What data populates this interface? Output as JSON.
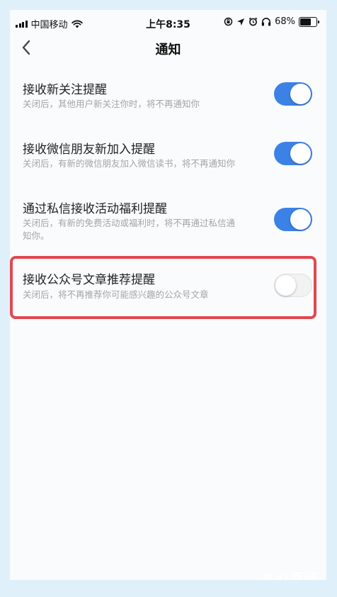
{
  "status_bar": {
    "carrier": "中国移动",
    "time": "上午8:35",
    "battery_percent": "68%",
    "battery_level": 0.68,
    "icons": [
      "signal-icon",
      "wifi-icon",
      "orientation-lock-icon",
      "location-icon",
      "alarm-icon",
      "headphones-icon",
      "battery-icon"
    ]
  },
  "nav": {
    "title": "通知",
    "back_icon": "chevron-left-icon"
  },
  "settings": [
    {
      "title": "接收新关注提醒",
      "description": "关闭后，其他用户新关注你时，将不再通知你",
      "enabled": true
    },
    {
      "title": "接收微信朋友新加入提醒",
      "description": "关闭后，有新的微信朋友加入微信读书，将不再通知你",
      "enabled": true
    },
    {
      "title": "通过私信接收活动福利提醒",
      "description": "关闭后，有新的免费活动或福利时，将不再通过私信通知你。",
      "enabled": true
    },
    {
      "title": "接收公众号文章推荐提醒",
      "description": "关闭后，将不再推荐你可能感兴趣的公众号文章",
      "enabled": false
    }
  ],
  "colors": {
    "page_background": "#dff0fb",
    "toggle_on": "#3c82e6",
    "highlight_border": "#e14850"
  },
  "watermark": {
    "text": "Bai百经验",
    "icon": "baidu-paw-icon"
  }
}
